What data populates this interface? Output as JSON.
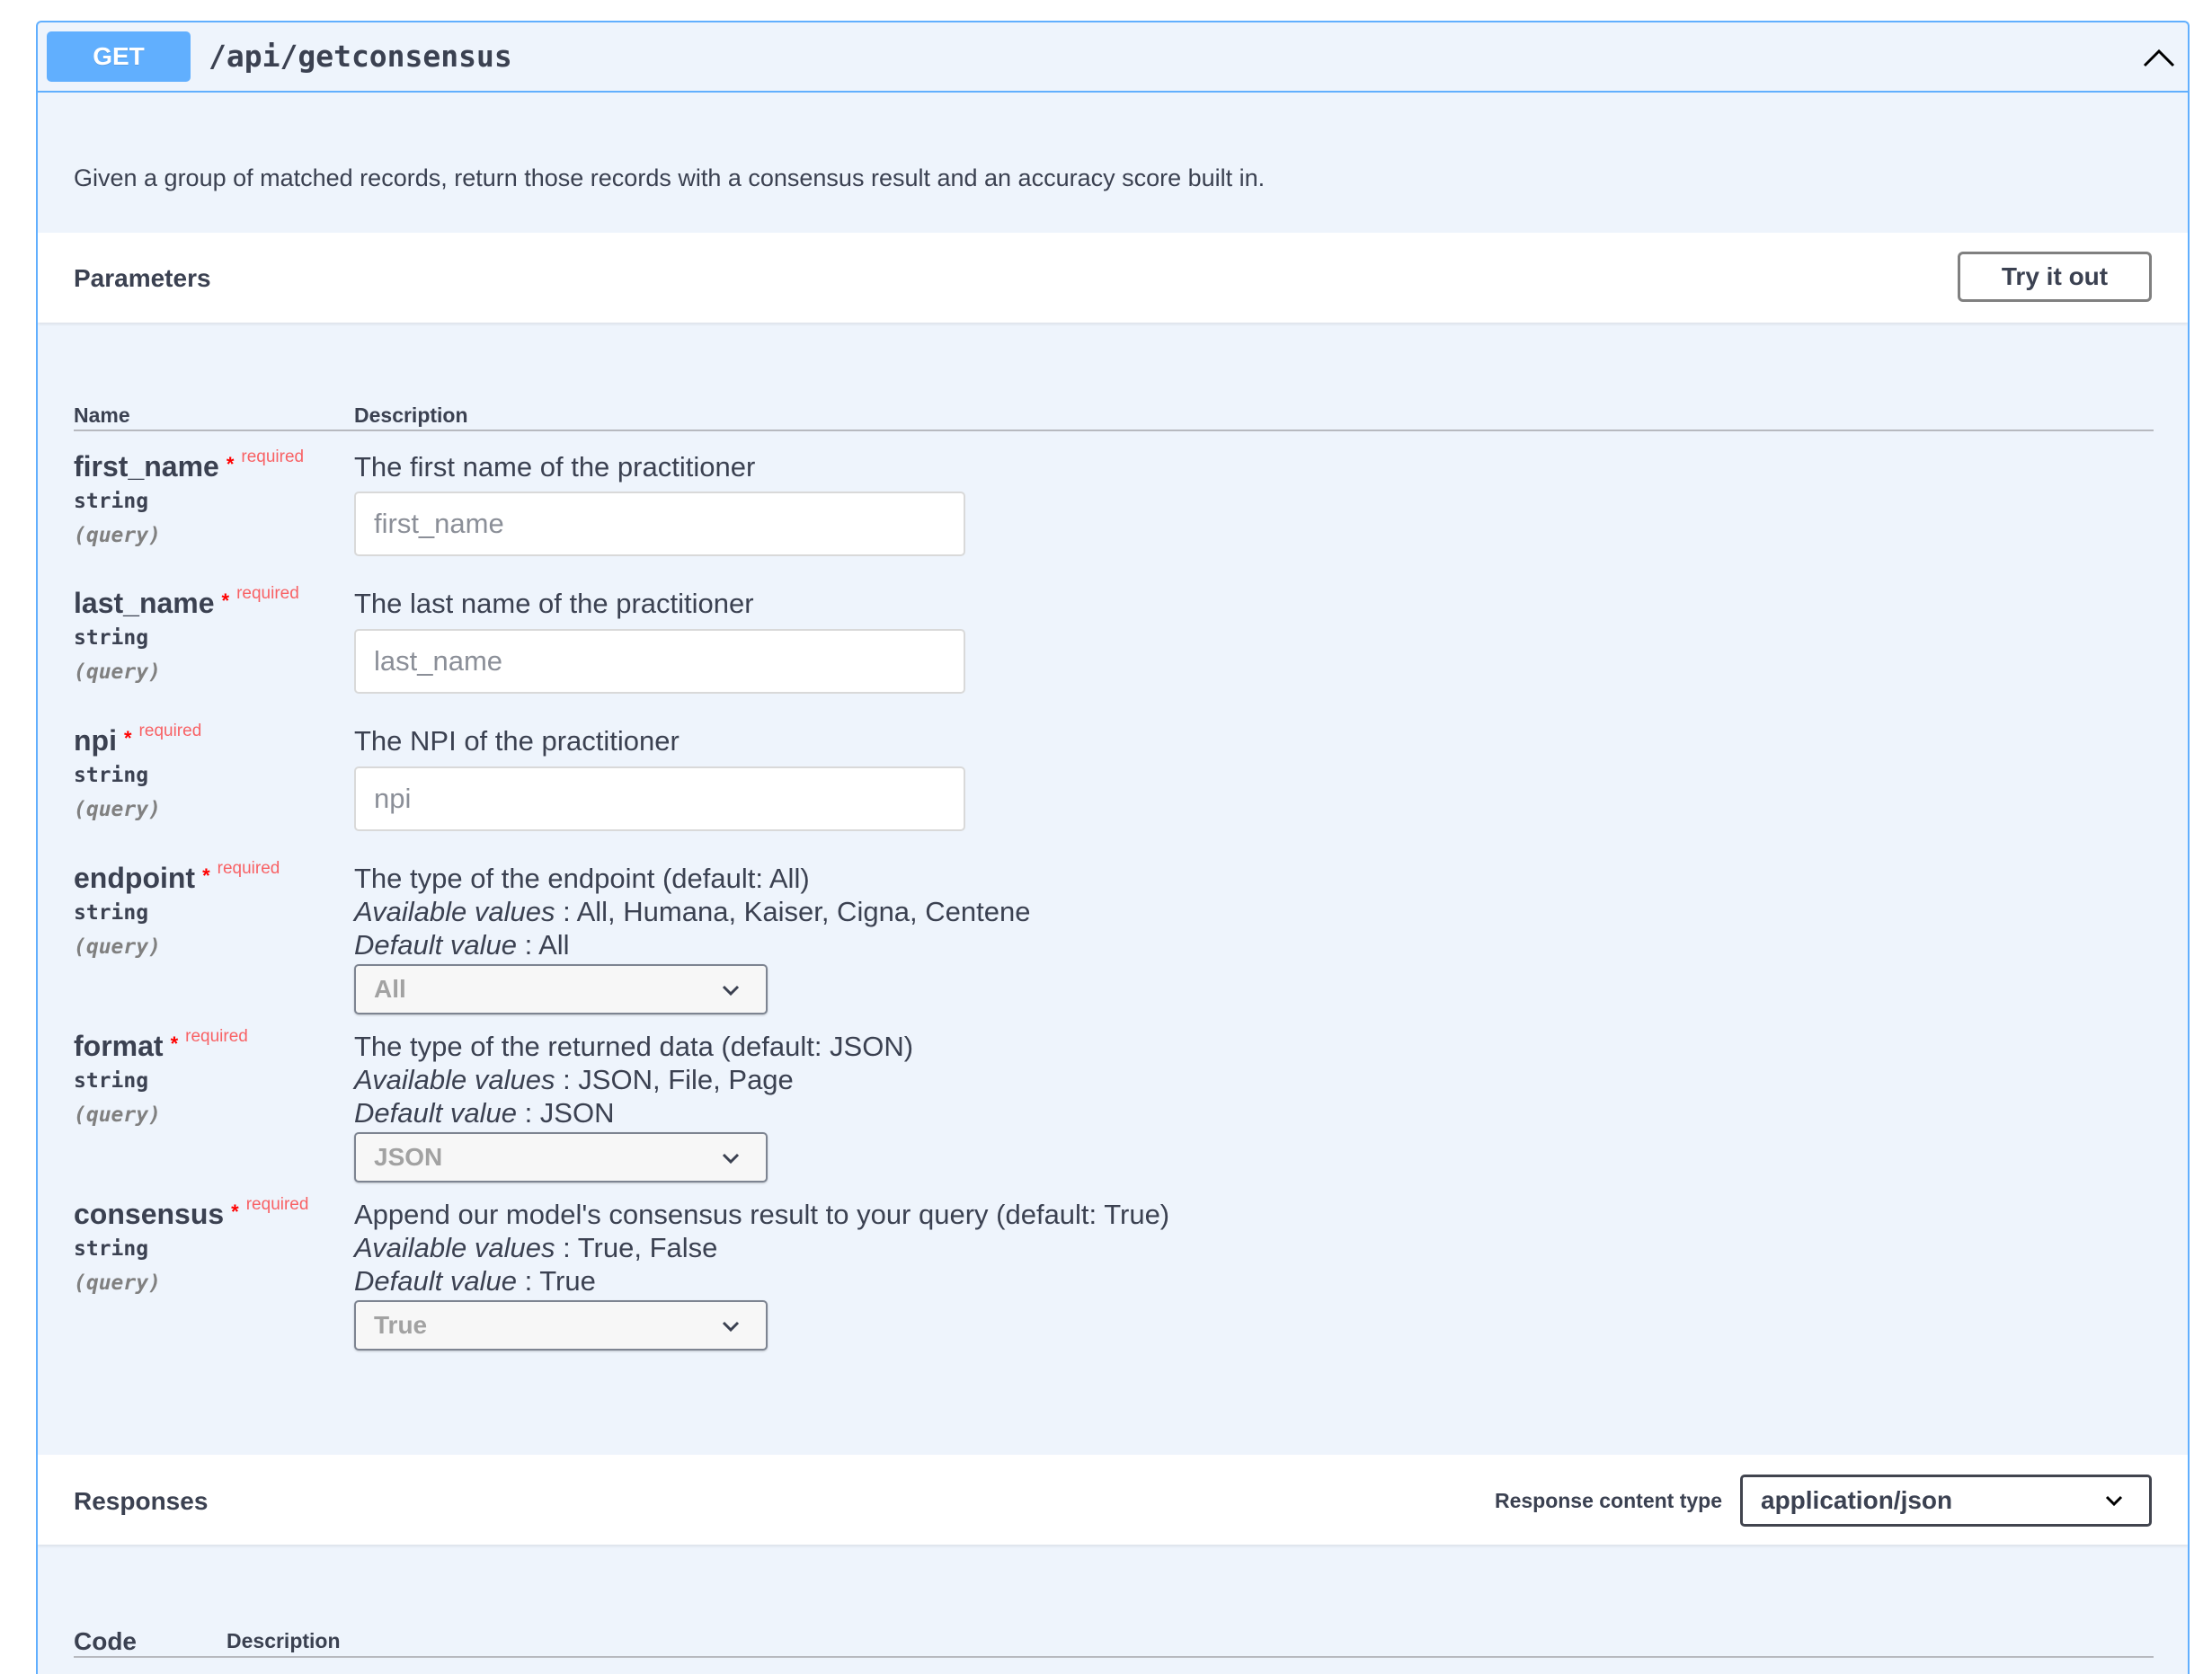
{
  "operation": {
    "method": "GET",
    "path": "/api/getconsensus",
    "description": "Given a group of matched records, return those records with a consensus result and an accuracy score built in."
  },
  "parameters_section": {
    "title": "Parameters",
    "try_button": "Try it out",
    "col_name": "Name",
    "col_description": "Description"
  },
  "params": [
    {
      "name": "first_name",
      "star": "*",
      "required": "required",
      "type": "string",
      "in": "(query)",
      "description": "The first name of the practitioner",
      "placeholder": "first_name"
    },
    {
      "name": "last_name",
      "star": "*",
      "required": "required",
      "type": "string",
      "in": "(query)",
      "description": "The last name of the practitioner",
      "placeholder": "last_name"
    },
    {
      "name": "npi",
      "star": "*",
      "required": "required",
      "type": "string",
      "in": "(query)",
      "description": "The NPI of the practitioner",
      "placeholder": "npi"
    },
    {
      "name": "endpoint",
      "star": "*",
      "required": "required",
      "type": "string",
      "in": "(query)",
      "description": "The type of the endpoint (default: All)",
      "available_label": "Available values",
      "available_values": " : All, Humana, Kaiser, Cigna, Centene",
      "default_label": "Default value",
      "default_value": " : All",
      "selected": "All"
    },
    {
      "name": "format",
      "star": "*",
      "required": "required",
      "type": "string",
      "in": "(query)",
      "description": "The type of the returned data (default: JSON)",
      "available_label": "Available values",
      "available_values": " : JSON, File, Page",
      "default_label": "Default value",
      "default_value": " : JSON",
      "selected": "JSON"
    },
    {
      "name": "consensus",
      "star": "*",
      "required": "required",
      "type": "string",
      "in": "(query)",
      "description": "Append our model's consensus result to your query (default: True)",
      "available_label": "Available values",
      "available_values": " : True, False",
      "default_label": "Default value",
      "default_value": " : True",
      "selected": "True"
    }
  ],
  "responses_section": {
    "title": "Responses",
    "content_type_label": "Response content type",
    "content_type_value": "application/json",
    "col_code": "Code",
    "col_description": "Description"
  },
  "colors": {
    "get_accent": "#61affe",
    "block_bg": "#eef4fc",
    "required": "#ff0000",
    "text": "#3b4151"
  },
  "icons": {
    "collapse": "chevron-up-icon",
    "select": "chevron-down-icon"
  }
}
